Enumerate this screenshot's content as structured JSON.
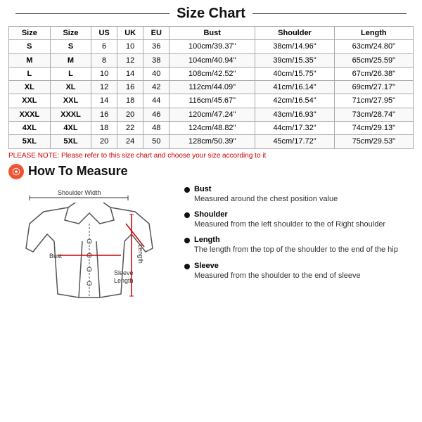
{
  "title": "Size Chart",
  "table": {
    "headers": [
      "Size",
      "Size",
      "US",
      "UK",
      "EU",
      "Bust",
      "Shoulder",
      "Length"
    ],
    "rows": [
      [
        "S",
        "S",
        "6",
        "10",
        "36",
        "100cm/39.37\"",
        "38cm/14.96\"",
        "63cm/24.80\""
      ],
      [
        "M",
        "M",
        "8",
        "12",
        "38",
        "104cm/40.94\"",
        "39cm/15.35\"",
        "65cm/25.59\""
      ],
      [
        "L",
        "L",
        "10",
        "14",
        "40",
        "108cm/42.52\"",
        "40cm/15.75\"",
        "67cm/26.38\""
      ],
      [
        "XL",
        "XL",
        "12",
        "16",
        "42",
        "112cm/44.09\"",
        "41cm/16.14\"",
        "69cm/27.17\""
      ],
      [
        "XXL",
        "XXL",
        "14",
        "18",
        "44",
        "116cm/45.67\"",
        "42cm/16.54\"",
        "71cm/27.95\""
      ],
      [
        "XXXL",
        "XXXL",
        "16",
        "20",
        "46",
        "120cm/47.24\"",
        "43cm/16.93\"",
        "73cm/28.74\""
      ],
      [
        "4XL",
        "4XL",
        "18",
        "22",
        "48",
        "124cm/48.82\"",
        "44cm/17.32\"",
        "74cm/29.13\""
      ],
      [
        "5XL",
        "5XL",
        "20",
        "24",
        "50",
        "128cm/50.39\"",
        "45cm/17.72\"",
        "75cm/29.53\""
      ]
    ]
  },
  "note": "PLEASE NOTE: Please refer to this size chart and choose your size according to it",
  "how_to_measure": {
    "heading": "How To Measure",
    "labels": {
      "shoulder_width": "Shoulder Width",
      "bust": "Bust",
      "sleeve_length": "Sleeve Length",
      "length": "Length"
    },
    "items": [
      {
        "name": "Bust",
        "desc": "Measured around the chest position value"
      },
      {
        "name": "Shoulder",
        "desc": "Measured from the left shoulder to the of Right shoulder"
      },
      {
        "name": "Length",
        "desc": "The length from the top of the shoulder to the end of the hip"
      },
      {
        "name": "Sleeve",
        "desc": "Measured from the shoulder to the end of sleeve"
      }
    ]
  }
}
